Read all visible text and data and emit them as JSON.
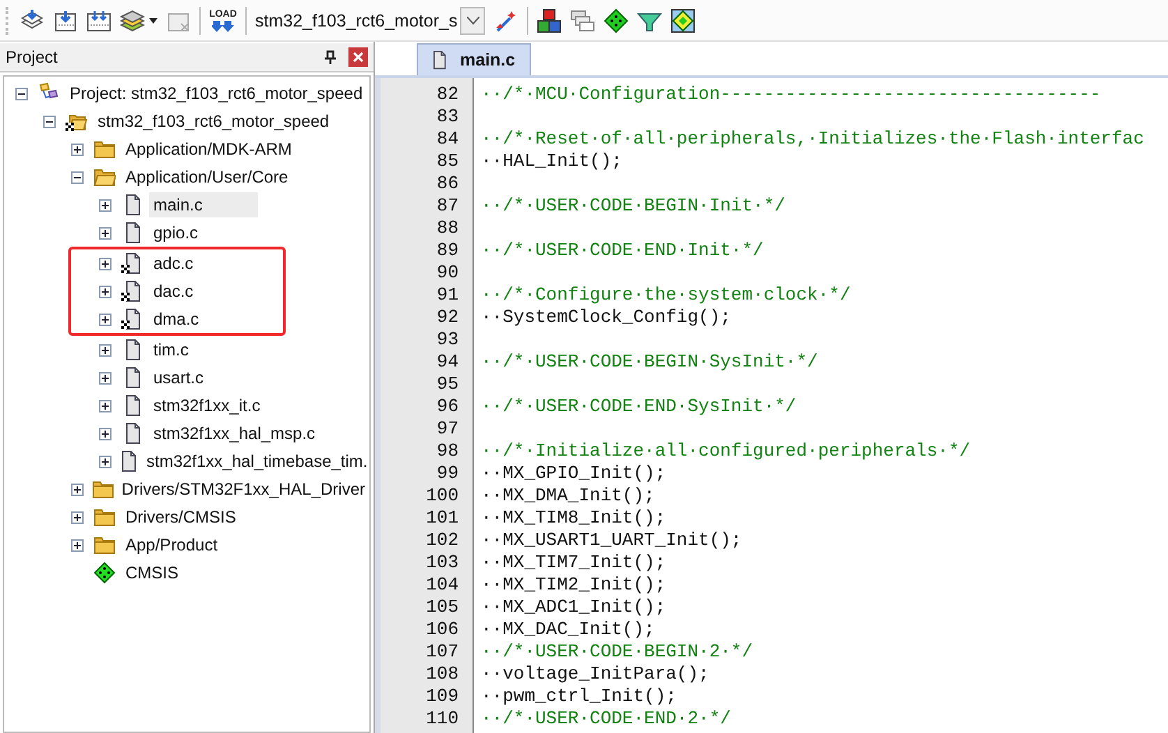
{
  "toolbar": {
    "target": "stm32_f103_rct6_motor_s",
    "load_label": "LOAD"
  },
  "project_panel": {
    "title": "Project",
    "tree": [
      {
        "kind": "project",
        "label": "Project: stm32_f103_rct6_motor_speed",
        "expanded": true,
        "children": [
          {
            "kind": "target",
            "label": "stm32_f103_rct6_motor_speed",
            "expanded": true,
            "options": true,
            "children": [
              {
                "kind": "group",
                "label": "Application/MDK-ARM",
                "expanded": false
              },
              {
                "kind": "group",
                "label": "Application/User/Core",
                "expanded": true,
                "children": [
                  {
                    "kind": "file",
                    "label": "main.c",
                    "expanded": false,
                    "selected": true,
                    "options": false,
                    "highlighted": false
                  },
                  {
                    "kind": "file",
                    "label": "gpio.c",
                    "expanded": false,
                    "selected": false,
                    "options": false,
                    "highlighted": false
                  },
                  {
                    "kind": "file",
                    "label": "adc.c",
                    "expanded": false,
                    "selected": false,
                    "options": true,
                    "highlighted": true
                  },
                  {
                    "kind": "file",
                    "label": "dac.c",
                    "expanded": false,
                    "selected": false,
                    "options": true,
                    "highlighted": true
                  },
                  {
                    "kind": "file",
                    "label": "dma.c",
                    "expanded": false,
                    "selected": false,
                    "options": true,
                    "highlighted": true
                  },
                  {
                    "kind": "file",
                    "label": "tim.c",
                    "expanded": false,
                    "selected": false,
                    "options": false,
                    "highlighted": false
                  },
                  {
                    "kind": "file",
                    "label": "usart.c",
                    "expanded": false,
                    "selected": false,
                    "options": false,
                    "highlighted": false
                  },
                  {
                    "kind": "file",
                    "label": "stm32f1xx_it.c",
                    "expanded": false,
                    "selected": false,
                    "options": false,
                    "highlighted": false
                  },
                  {
                    "kind": "file",
                    "label": "stm32f1xx_hal_msp.c",
                    "expanded": false,
                    "selected": false,
                    "options": false,
                    "highlighted": false
                  },
                  {
                    "kind": "file",
                    "label": "stm32f1xx_hal_timebase_tim.",
                    "expanded": false,
                    "selected": false,
                    "options": false,
                    "highlighted": false
                  }
                ]
              },
              {
                "kind": "group",
                "label": "Drivers/STM32F1xx_HAL_Driver",
                "expanded": false
              },
              {
                "kind": "group",
                "label": "Drivers/CMSIS",
                "expanded": false
              },
              {
                "kind": "group",
                "label": "App/Product",
                "expanded": false
              },
              {
                "kind": "component",
                "label": "CMSIS"
              }
            ]
          }
        ]
      }
    ]
  },
  "editor": {
    "tabs": [
      {
        "label": "main.c",
        "selected": true
      }
    ],
    "lines": [
      {
        "number": "82",
        "kind": "comment",
        "text": "··/*·MCU·Configuration-----------------------------------"
      },
      {
        "number": "83"
      },
      {
        "number": "84",
        "kind": "comment",
        "text": "··/*·Reset·of·all·peripherals,·Initializes·the·Flash·interfac"
      },
      {
        "number": "85",
        "kind": "code",
        "text": "··HAL_Init();"
      },
      {
        "number": "86"
      },
      {
        "number": "87",
        "kind": "comment",
        "text": "··/*·USER·CODE·BEGIN·Init·*/"
      },
      {
        "number": "88"
      },
      {
        "number": "89",
        "kind": "comment",
        "text": "··/*·USER·CODE·END·Init·*/"
      },
      {
        "number": "90"
      },
      {
        "number": "91",
        "kind": "comment",
        "text": "··/*·Configure·the·system·clock·*/"
      },
      {
        "number": "92",
        "kind": "code",
        "text": "··SystemClock_Config();"
      },
      {
        "number": "93"
      },
      {
        "number": "94",
        "kind": "comment",
        "text": "··/*·USER·CODE·BEGIN·SysInit·*/"
      },
      {
        "number": "95"
      },
      {
        "number": "96",
        "kind": "comment",
        "text": "··/*·USER·CODE·END·SysInit·*/"
      },
      {
        "number": "97"
      },
      {
        "number": "98",
        "kind": "comment",
        "text": "··/*·Initialize·all·configured·peripherals·*/"
      },
      {
        "number": "99",
        "kind": "code",
        "text": "··MX_GPIO_Init();"
      },
      {
        "number": "100",
        "kind": "code",
        "text": "··MX_DMA_Init();"
      },
      {
        "number": "101",
        "kind": "code",
        "text": "··MX_TIM8_Init();"
      },
      {
        "number": "102",
        "kind": "code",
        "text": "··MX_USART1_UART_Init();"
      },
      {
        "number": "103",
        "kind": "code",
        "text": "··MX_TIM7_Init();"
      },
      {
        "number": "104",
        "kind": "code",
        "text": "··MX_TIM2_Init();"
      },
      {
        "number": "105",
        "kind": "code",
        "text": "··MX_ADC1_Init();"
      },
      {
        "number": "106",
        "kind": "code",
        "text": "··MX_DAC_Init();"
      },
      {
        "number": "107",
        "kind": "comment",
        "text": "··/*·USER·CODE·BEGIN·2·*/"
      },
      {
        "number": "108",
        "kind": "code",
        "text": "··voltage_InitPara();"
      },
      {
        "number": "109",
        "kind": "code",
        "text": "··pwm_ctrl_Init();"
      },
      {
        "number": "110",
        "kind": "comment",
        "text": "··/*·USER·CODE·END·2·*/"
      }
    ]
  }
}
